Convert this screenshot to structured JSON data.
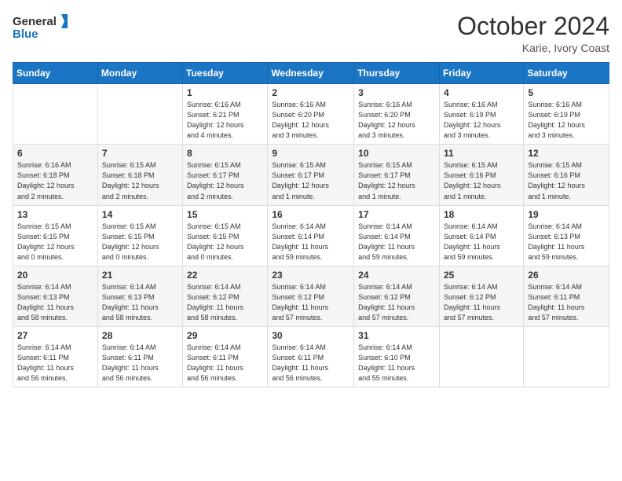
{
  "header": {
    "logo_line1": "General",
    "logo_line2": "Blue",
    "month_title": "October 2024",
    "location": "Karie, Ivory Coast"
  },
  "days_of_week": [
    "Sunday",
    "Monday",
    "Tuesday",
    "Wednesday",
    "Thursday",
    "Friday",
    "Saturday"
  ],
  "weeks": [
    [
      {
        "day": "",
        "info": ""
      },
      {
        "day": "",
        "info": ""
      },
      {
        "day": "1",
        "info": "Sunrise: 6:16 AM\nSunset: 6:21 PM\nDaylight: 12 hours\nand 4 minutes."
      },
      {
        "day": "2",
        "info": "Sunrise: 6:16 AM\nSunset: 6:20 PM\nDaylight: 12 hours\nand 3 minutes."
      },
      {
        "day": "3",
        "info": "Sunrise: 6:16 AM\nSunset: 6:20 PM\nDaylight: 12 hours\nand 3 minutes."
      },
      {
        "day": "4",
        "info": "Sunrise: 6:16 AM\nSunset: 6:19 PM\nDaylight: 12 hours\nand 3 minutes."
      },
      {
        "day": "5",
        "info": "Sunrise: 6:16 AM\nSunset: 6:19 PM\nDaylight: 12 hours\nand 3 minutes."
      }
    ],
    [
      {
        "day": "6",
        "info": "Sunrise: 6:16 AM\nSunset: 6:18 PM\nDaylight: 12 hours\nand 2 minutes."
      },
      {
        "day": "7",
        "info": "Sunrise: 6:15 AM\nSunset: 6:18 PM\nDaylight: 12 hours\nand 2 minutes."
      },
      {
        "day": "8",
        "info": "Sunrise: 6:15 AM\nSunset: 6:17 PM\nDaylight: 12 hours\nand 2 minutes."
      },
      {
        "day": "9",
        "info": "Sunrise: 6:15 AM\nSunset: 6:17 PM\nDaylight: 12 hours\nand 1 minute."
      },
      {
        "day": "10",
        "info": "Sunrise: 6:15 AM\nSunset: 6:17 PM\nDaylight: 12 hours\nand 1 minute."
      },
      {
        "day": "11",
        "info": "Sunrise: 6:15 AM\nSunset: 6:16 PM\nDaylight: 12 hours\nand 1 minute."
      },
      {
        "day": "12",
        "info": "Sunrise: 6:15 AM\nSunset: 6:16 PM\nDaylight: 12 hours\nand 1 minute."
      }
    ],
    [
      {
        "day": "13",
        "info": "Sunrise: 6:15 AM\nSunset: 6:15 PM\nDaylight: 12 hours\nand 0 minutes."
      },
      {
        "day": "14",
        "info": "Sunrise: 6:15 AM\nSunset: 6:15 PM\nDaylight: 12 hours\nand 0 minutes."
      },
      {
        "day": "15",
        "info": "Sunrise: 6:15 AM\nSunset: 6:15 PM\nDaylight: 12 hours\nand 0 minutes."
      },
      {
        "day": "16",
        "info": "Sunrise: 6:14 AM\nSunset: 6:14 PM\nDaylight: 11 hours\nand 59 minutes."
      },
      {
        "day": "17",
        "info": "Sunrise: 6:14 AM\nSunset: 6:14 PM\nDaylight: 11 hours\nand 59 minutes."
      },
      {
        "day": "18",
        "info": "Sunrise: 6:14 AM\nSunset: 6:14 PM\nDaylight: 11 hours\nand 59 minutes."
      },
      {
        "day": "19",
        "info": "Sunrise: 6:14 AM\nSunset: 6:13 PM\nDaylight: 11 hours\nand 59 minutes."
      }
    ],
    [
      {
        "day": "20",
        "info": "Sunrise: 6:14 AM\nSunset: 6:13 PM\nDaylight: 11 hours\nand 58 minutes."
      },
      {
        "day": "21",
        "info": "Sunrise: 6:14 AM\nSunset: 6:13 PM\nDaylight: 11 hours\nand 58 minutes."
      },
      {
        "day": "22",
        "info": "Sunrise: 6:14 AM\nSunset: 6:12 PM\nDaylight: 11 hours\nand 58 minutes."
      },
      {
        "day": "23",
        "info": "Sunrise: 6:14 AM\nSunset: 6:12 PM\nDaylight: 11 hours\nand 57 minutes."
      },
      {
        "day": "24",
        "info": "Sunrise: 6:14 AM\nSunset: 6:12 PM\nDaylight: 11 hours\nand 57 minutes."
      },
      {
        "day": "25",
        "info": "Sunrise: 6:14 AM\nSunset: 6:12 PM\nDaylight: 11 hours\nand 57 minutes."
      },
      {
        "day": "26",
        "info": "Sunrise: 6:14 AM\nSunset: 6:11 PM\nDaylight: 11 hours\nand 57 minutes."
      }
    ],
    [
      {
        "day": "27",
        "info": "Sunrise: 6:14 AM\nSunset: 6:11 PM\nDaylight: 11 hours\nand 56 minutes."
      },
      {
        "day": "28",
        "info": "Sunrise: 6:14 AM\nSunset: 6:11 PM\nDaylight: 11 hours\nand 56 minutes."
      },
      {
        "day": "29",
        "info": "Sunrise: 6:14 AM\nSunset: 6:11 PM\nDaylight: 11 hours\nand 56 minutes."
      },
      {
        "day": "30",
        "info": "Sunrise: 6:14 AM\nSunset: 6:11 PM\nDaylight: 11 hours\nand 56 minutes."
      },
      {
        "day": "31",
        "info": "Sunrise: 6:14 AM\nSunset: 6:10 PM\nDaylight: 11 hours\nand 55 minutes."
      },
      {
        "day": "",
        "info": ""
      },
      {
        "day": "",
        "info": ""
      }
    ]
  ]
}
